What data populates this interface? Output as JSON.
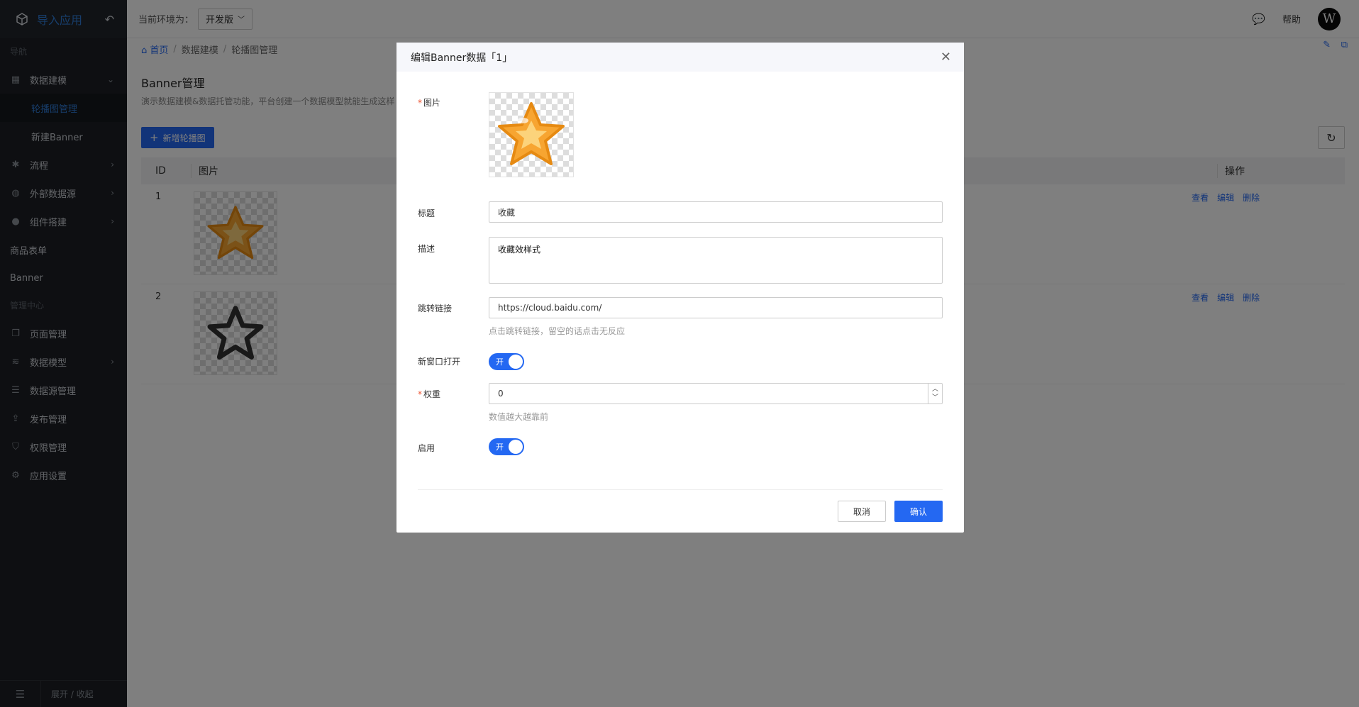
{
  "app": {
    "name": "导入应用"
  },
  "sidebar": {
    "section_nav": "导航",
    "section_admin": "管理中心",
    "items": [
      {
        "label": "数据建模",
        "icon": "database-icon"
      },
      {
        "label": "轮播图管理",
        "icon": ""
      },
      {
        "label": "新建Banner",
        "icon": ""
      },
      {
        "label": "流程",
        "icon": "asterisk-icon"
      },
      {
        "label": "外部数据源",
        "icon": "globe-icon"
      },
      {
        "label": "组件搭建",
        "icon": "compass-icon"
      },
      {
        "label": "商品表单",
        "icon": ""
      },
      {
        "label": "Banner",
        "icon": ""
      },
      {
        "label": "页面管理",
        "icon": "pages-icon"
      },
      {
        "label": "数据模型",
        "icon": "stack-icon"
      },
      {
        "label": "数据源管理",
        "icon": "list-icon"
      },
      {
        "label": "发布管理",
        "icon": "upload-icon"
      },
      {
        "label": "权限管理",
        "icon": "shield-icon"
      },
      {
        "label": "应用设置",
        "icon": "gear-icon"
      }
    ],
    "collapse_label": "展开 / 收起"
  },
  "topbar": {
    "env_label": "当前环境为：",
    "env_value": "开发版",
    "help": "帮助",
    "avatar_letter": "W"
  },
  "breadcrumb": {
    "home": "首页",
    "level2": "数据建模",
    "level3": "轮播图管理"
  },
  "page": {
    "title": "Banner管理",
    "desc": "演示数据建模&数据托管功能，平台创建一个数据模型就能生成这样",
    "add_button": "新增轮播图"
  },
  "table": {
    "headers": {
      "id": "ID",
      "image": "图片",
      "ops": "操作"
    },
    "rows": [
      {
        "id": "1",
        "ops": [
          "查看",
          "编辑",
          "删除"
        ]
      },
      {
        "id": "2",
        "ops": [
          "查看",
          "编辑",
          "删除"
        ]
      }
    ]
  },
  "modal": {
    "title": "编辑Banner数据「1」",
    "fields": {
      "image_label": "图片",
      "title_label": "标题",
      "title_value": "收藏",
      "desc_label": "描述",
      "desc_value": "收藏效样式",
      "link_label": "跳转链接",
      "link_value": "https://cloud.baidu.com/",
      "link_hint": "点击跳转链接，留空的话点击无反应",
      "new_window_label": "新窗口打开",
      "new_window_state": "开",
      "weight_label": "权重",
      "weight_value": "0",
      "weight_hint": "数值越大越靠前",
      "enabled_label": "启用",
      "enabled_state": "开"
    },
    "cancel": "取消",
    "confirm": "确认"
  },
  "colors": {
    "accent": "#2468f2",
    "sidebar_bg": "#1c1f24",
    "star": "#f7a531"
  }
}
